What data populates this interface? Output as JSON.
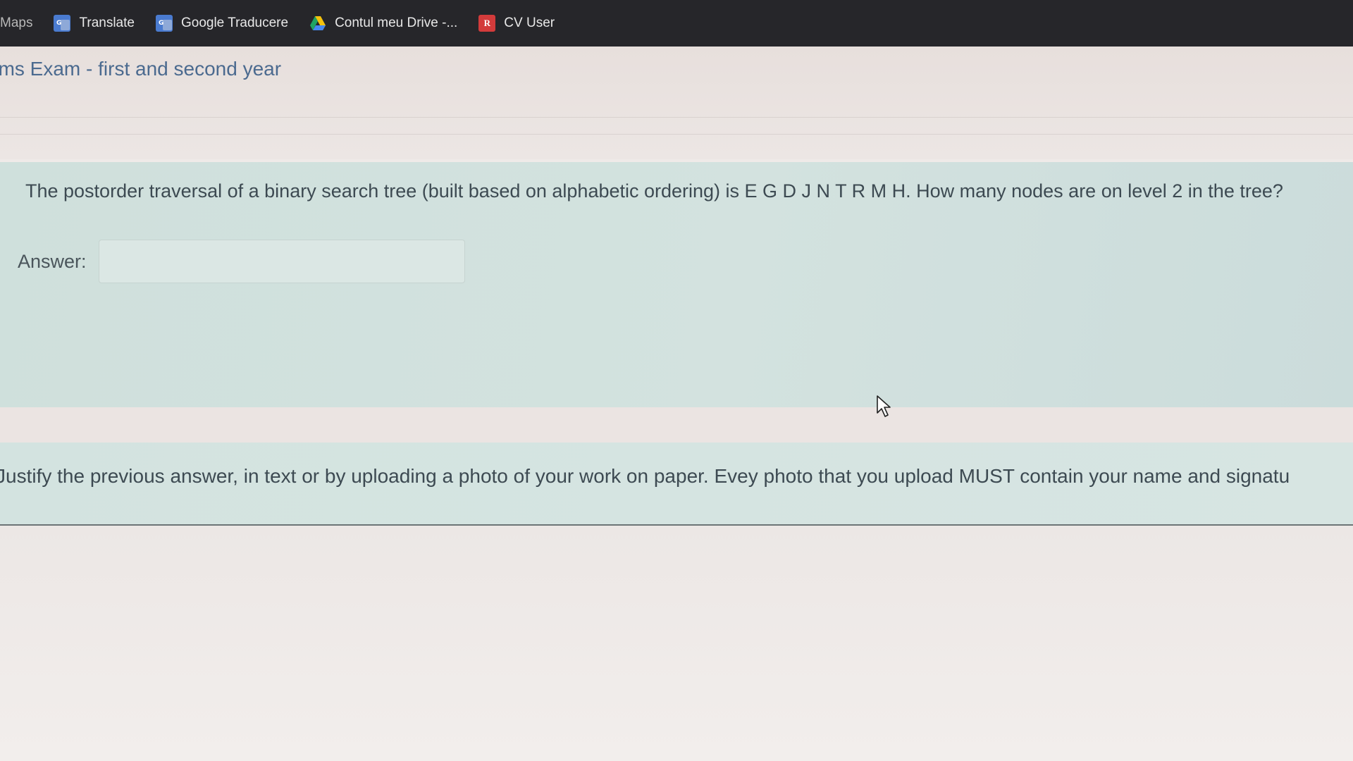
{
  "bookmarks": {
    "items": [
      {
        "label": "Maps",
        "icon": "maps-icon"
      },
      {
        "label": "Translate",
        "icon": "google-translate-icon"
      },
      {
        "label": "Google Traducere",
        "icon": "google-translate-icon"
      },
      {
        "label": "Contul meu Drive -...",
        "icon": "google-drive-icon"
      },
      {
        "label": "CV User",
        "icon": "cv-r-icon",
        "icon_text": "R"
      }
    ]
  },
  "page": {
    "title": "ams Exam - first and second year"
  },
  "question": {
    "text": "The postorder traversal of a binary search tree (built based on alphabetic ordering) is E G D J N T R M H. How many nodes are on level 2 in the tree?",
    "answer_label": "Answer:",
    "answer_value": ""
  },
  "justify": {
    "text": "Justify the previous answer, in text or by uploading a photo of your work on paper. Evey photo that you upload MUST contain your name and signatu"
  },
  "colors": {
    "bookmarks_bg": "#26262a",
    "title_color": "#4b6a8f",
    "card_bg": "#d3e2df",
    "text_color": "#3d4a52"
  }
}
